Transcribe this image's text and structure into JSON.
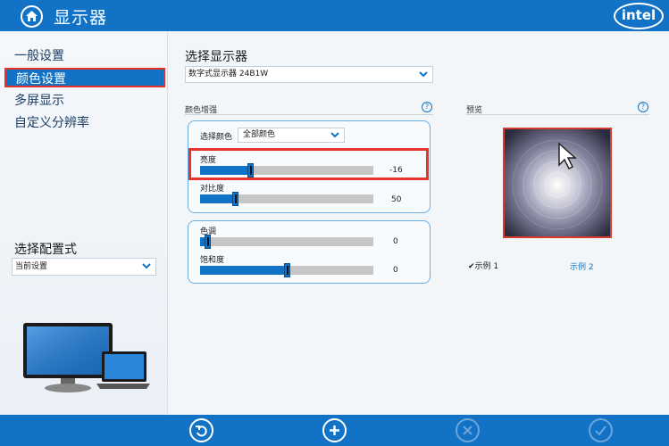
{
  "header": {
    "title": "显示器",
    "logo_text": "intel",
    "home_icon": "home-icon"
  },
  "sidebar": {
    "items": [
      {
        "label": "一般设置",
        "active": false
      },
      {
        "label": "颜色设置",
        "active": true
      },
      {
        "label": "多屏显示",
        "active": false
      },
      {
        "label": "自定义分辨率",
        "active": false
      }
    ],
    "profile_label": "选择配置式",
    "profile_value": "当前设置"
  },
  "main": {
    "select_display_label": "选择显示器",
    "display_value": "数字式显示器 24B1W",
    "color_enhance_label": "颜色增强",
    "preview_label": "预览",
    "help_glyph": "?",
    "color_select_label": "选择颜色",
    "color_select_value": "全部颜色",
    "sliders": {
      "brightness": {
        "label": "亮度",
        "value": "-16",
        "fraction": 0.29
      },
      "contrast": {
        "label": "对比度",
        "value": "50",
        "fraction": 0.2
      },
      "hue": {
        "label": "色调",
        "value": "0",
        "fraction": 0.04
      },
      "saturation": {
        "label": "饱和度",
        "value": "0",
        "fraction": 0.5
      }
    },
    "sample1": "✔示例 1",
    "sample2": "示例 2"
  },
  "footer": {
    "buttons": [
      {
        "icon": "undo-icon",
        "enabled": true
      },
      {
        "icon": "plus-icon",
        "enabled": true
      },
      {
        "icon": "cancel-icon",
        "enabled": false
      },
      {
        "icon": "apply-check-icon",
        "enabled": false
      }
    ]
  },
  "colors": {
    "accent": "#1273c6",
    "highlight": "#e6332a",
    "track": "#c6c6c6"
  }
}
